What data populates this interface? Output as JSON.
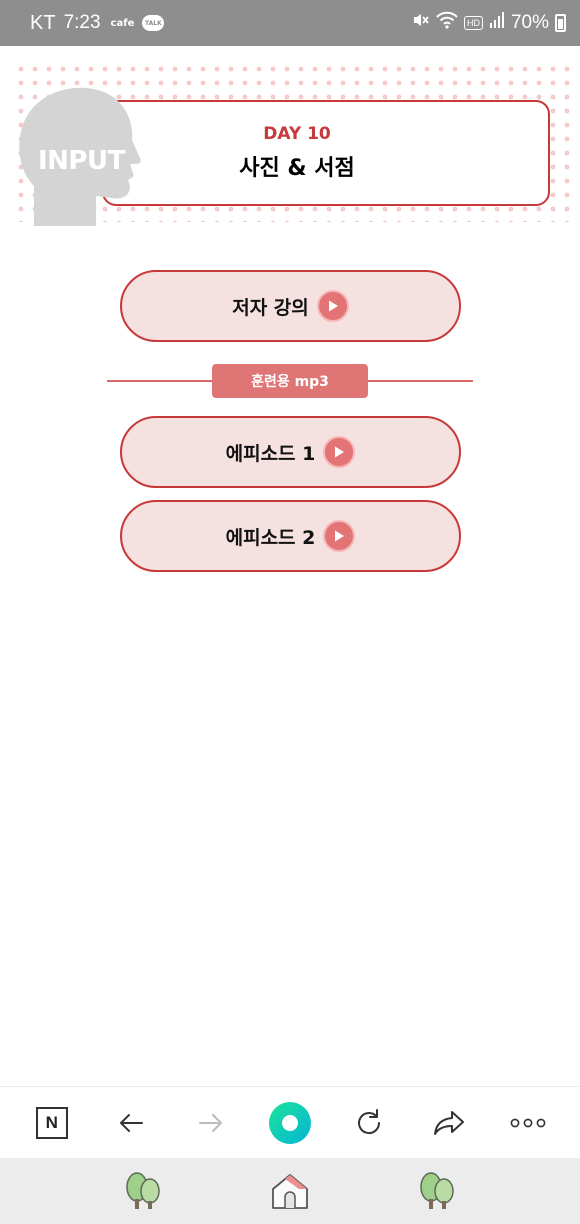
{
  "status_bar": {
    "carrier": "KT",
    "time": "7:23",
    "cafe": "cafe",
    "talk": "TALK",
    "hd": "HD",
    "battery": "70%"
  },
  "header": {
    "input_label": "INPUT",
    "day_label": "DAY 10",
    "topic": "사진 & 서점"
  },
  "buttons": {
    "author_lecture": "저자 강의",
    "mp3_divider": "훈련용 mp3",
    "episode_1": "에피소드 1",
    "episode_2": "에피소드 2"
  },
  "colors": {
    "accent": "#c7393a",
    "pill_fill": "#f6e1e1",
    "play": "#e27475",
    "dots": "#f6c9c9",
    "status_bar": "#8e8e8e"
  },
  "toolbar": {
    "icons": [
      "naver-icon",
      "back-arrow-icon",
      "forward-arrow-icon",
      "green-circle-icon",
      "refresh-icon",
      "share-icon",
      "more-icon"
    ]
  },
  "dock": {
    "icons": [
      "tree-icon",
      "home-icon",
      "tree-icon"
    ]
  }
}
